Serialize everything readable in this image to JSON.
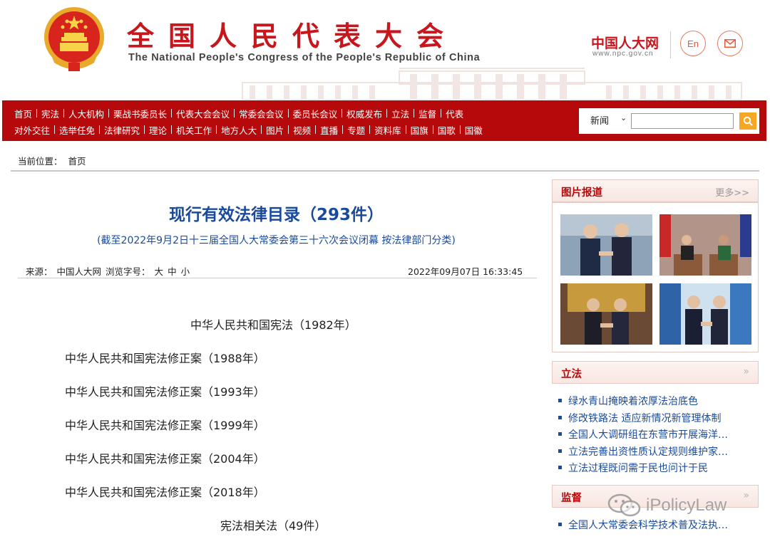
{
  "header": {
    "title_cn": "全国人民代表大会",
    "title_en": "The National People's Congress of the People's Republic of China",
    "site_name": "中国人大网",
    "site_url": "www.npc.gov.cn",
    "lang_btn": "En",
    "mail_icon": "mail-icon",
    "emblem_icon": "national-emblem-icon"
  },
  "nav": {
    "row1": [
      "首页",
      "宪法",
      "人大机构",
      "栗战书委员长",
      "代表大会会议",
      "常委会会议",
      "委员长会议",
      "权威发布",
      "立法",
      "监督",
      "代表"
    ],
    "row2": [
      "对外交往",
      "选举任免",
      "法律研究",
      "理论",
      "机关工作",
      "地方人大",
      "图片",
      "视频",
      "直播",
      "专题",
      "资料库",
      "国旗",
      "国歌",
      "国徽"
    ]
  },
  "search": {
    "category": "新闻",
    "value": "",
    "placeholder": ""
  },
  "breadcrumb": {
    "label": "当前位置：",
    "home": "首页"
  },
  "article": {
    "title": "现行有效法律目录（293件）",
    "subtitle": "(截至2022年9月2日十三届全国人大常委会第三十六次会议闭幕 按法律部门分类)",
    "source_label": "来源：",
    "source": "中国人大网",
    "fontsize_label": "浏览字号：",
    "font_large": "大",
    "font_medium": "中",
    "font_small": "小",
    "date": "2022年09月07日 16:33:45",
    "laws": [
      "中华人民共和国宪法（1982年）",
      "中华人民共和国宪法修正案（1988年）",
      "中华人民共和国宪法修正案（1993年）",
      "中华人民共和国宪法修正案（1999年）",
      "中华人民共和国宪法修正案（2004年）",
      "中华人民共和国宪法修正案（2018年）",
      "宪法相关法（49件）"
    ]
  },
  "sidebar": {
    "photos": {
      "title": "图片报道",
      "more": "更多>>"
    },
    "legislation": {
      "title": "立法",
      "more_icon": "double-chevron-right-icon",
      "items": [
        "绿水青山掩映着浓厚法治底色",
        "修改铁路法 适应新情况新管理体制",
        "全国人大调研组在东营市开展海洋…",
        "立法完善出资性质认定规则维护家…",
        "立法过程既问需于民也问计于民"
      ]
    },
    "supervision": {
      "title": "监督",
      "more_icon": "double-chevron-right-icon",
      "items": [
        "全国人大常委会科学技术普及法执…"
      ]
    }
  },
  "watermark": {
    "text": "iPolicyLaw",
    "icon": "wechat-icon"
  },
  "colors": {
    "brand_red": "#b5090b",
    "link_blue": "#1a4a9b",
    "search_orange": "#f6a723"
  }
}
